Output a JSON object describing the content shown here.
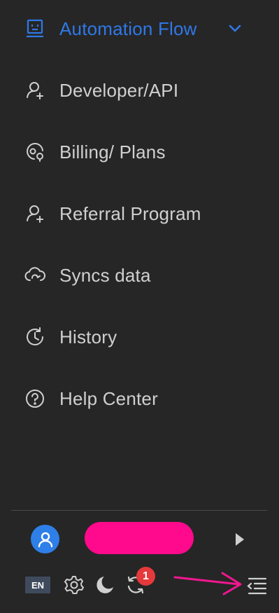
{
  "nav": {
    "items": [
      {
        "label": "Automation Flow",
        "icon": "robot-icon",
        "active": true
      },
      {
        "label": "Developer/API",
        "icon": "user-add-icon"
      },
      {
        "label": "Billing/ Plans",
        "icon": "billing-icon"
      },
      {
        "label": "Referral Program",
        "icon": "user-add-icon"
      },
      {
        "label": "Syncs data",
        "icon": "cloud-sync-icon"
      },
      {
        "label": "History",
        "icon": "history-icon"
      },
      {
        "label": "Help Center",
        "icon": "help-icon"
      }
    ]
  },
  "footer": {
    "language": "EN",
    "notification_count": "1"
  },
  "colors": {
    "background": "#262626",
    "accent": "#2f78e8",
    "text": "#d0d0d0",
    "badge": "#e5393b",
    "pill": "#ff0a8c",
    "annotation": "#f0178f"
  }
}
